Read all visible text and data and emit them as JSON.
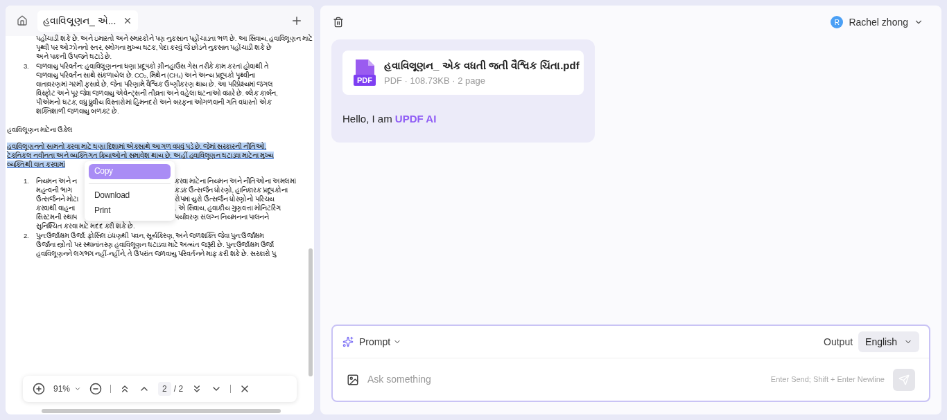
{
  "left_panel": {
    "tab": {
      "title": "હવાવિલૂણન_ એ...",
      "selected": true
    },
    "document": [
      {
        "kind": "text",
        "text": "પહોંચાડી શકે છે. અને ઇમારતો અને સ્મારકોને પણ નુકસાન પહોંચાડતા ભળ છે. આ સિવાય, હવાવિલૂણન માટે",
        "highlighted": false
      },
      {
        "kind": "text",
        "text": "પૃથ્વી પર ઓઝોનનો સ્તર, સ્મોગના મુખ્ય ઘટક, પેદા કરવું જે છોડને નુકસાન પહોંચાડી શકે છે",
        "highlighted": false
      },
      {
        "kind": "text",
        "text": "અને પાકની ઉપજને ઘટાડે છે.",
        "highlighted": false
      },
      {
        "kind": "item",
        "number": "3.",
        "text": "જળવાયુ પરિવર્તન: હવાવિલૂણનના ઘણા પ્રદૂષકો ગ્રીનહાઉસ ગેસ તરીકે કામ કરતાં હોવાથી તે",
        "highlighted": false
      },
      {
        "kind": "text",
        "text": "જળવાયુ પરિવર્તન સાથે સંકળાયેલ છે. CO₂, મિથેન (CH₄) અને અન્ય પ્રદૂષકો પૃથ્વીના",
        "highlighted": false
      },
      {
        "kind": "text",
        "text": "વાતાવરણમાં ગરમી ફસાવે છે, જેના પરિણામે વૈશ્વિક ઉષ્ણીકરણ થાય છે. આ પરિપ્રેક્ષ્યમાં જંગલ",
        "highlighted": false
      },
      {
        "kind": "text",
        "text": "વિસ્ફોટ અને પૂર જેવા જળવાયુ એવેન્ટ્સની તીવ્રતા અને વહેલા ઘટનાઓ વધારે છે. બ્લેક કાર્બન,",
        "highlighted": false
      },
      {
        "kind": "text",
        "text": "પીએમનો ઘટક, વધુ ધ્રુવીય વિસ્તારોમાં હિમનદરો અને બરફના ઓગળવાની ગતિ વધારતો એક",
        "highlighted": false
      },
      {
        "kind": "text",
        "text": "શક્તિશાળી જળવાયુ બળકટ છે.",
        "highlighted": false
      },
      {
        "kind": "heading",
        "text": "હવાવિલૂણન માટેના ઉકેલ",
        "highlighted": false
      },
      {
        "kind": "para",
        "text": "હવાવિલૂણનનો સામનો કરવા માટે ઘણા દિશામાં એકસાથે આગળ વધવું પડે છે. જેમાં સરકારની નીતિઓ,",
        "highlighted": true
      },
      {
        "kind": "para",
        "text": "ટેકનિકલ નવીનતા અને વ્યક્તિગત ક્રિયાઓનો સમાવેશ થાય છે. અહીં હવાવિલૂણન ઘટાડવા માટેના મુખ્ય",
        "highlighted": true
      },
      {
        "kind": "para",
        "text": "વ્યક્તિથી વાત કરવામાં",
        "highlighted": true
      },
      {
        "kind": "split",
        "number": "1.",
        "left": "નિયમન અને ન",
        "right": "કરવા માટેના નિયમન અને નીતિઓના અમલમાં",
        "highlighted": false
      },
      {
        "kind": "split",
        "left": "મહત્વની ભાગ",
        "right": "કડક ઉત્સર્જન ધોરણો, હાનિકારક પ્રદૂષકોના",
        "highlighted": false
      },
      {
        "kind": "split",
        "left": "ઉત્સર્જનને મોટા",
        "right": "રોપમાં યુરો ઉત્સર્જન ધોરણોનો પરિચય",
        "highlighted": false
      },
      {
        "kind": "split",
        "left": "કરવાથી વાહના",
        "right": ". એ સિવાય, હવાકીય ગુણવત્તા મોનિટરિંગ",
        "highlighted": false
      },
      {
        "kind": "split",
        "left": "સિસ્ટમની સ્થાપ",
        "right": "પર્યાવરણ સંલગ્ન નિયમનના પાલનને",
        "highlighted": false
      },
      {
        "kind": "text",
        "text": "સુનિશ્ચિત કરવા માટે મદદ કરી શકે છે.",
        "highlighted": false
      },
      {
        "kind": "item",
        "number": "2.",
        "text": "પુન:ઉર્જાક્ષમ ઉર્જા: ફોસિલ ઇંધણથી પવન, સૂર્યકિરણ, અને જળશક્તિ જેવા પુન:ઉર્જાક્ષમ",
        "highlighted": false
      },
      {
        "kind": "text",
        "text": "ઉર્જાના સ્ત્રોતો પર સ્થાનાંતરણ હવાવિલૂણન ઘટાડવા માટે અત્યંત જરૂરી છે. પુન:ઉર્જાક્ષમ ઉર્જા",
        "highlighted": false
      },
      {
        "kind": "text",
        "text": "હવાવિલૂણનને લગભગ નહીં-નહીંને, તે ઉપરાંત જળવાયુ પરિવર્તનને માફ કરી શકે છે. સરકારો પુ",
        "highlighted": false
      }
    ],
    "context_menu": [
      {
        "label": "Copy",
        "selected": true
      },
      {
        "label": "Download",
        "selected": false
      },
      {
        "label": "Print",
        "selected": false
      }
    ],
    "toolbar": {
      "zoom": "91%",
      "page": "2",
      "total": "/ 2"
    }
  },
  "right_panel": {
    "user": {
      "initial": "R",
      "name": "Rachel zhong"
    },
    "file": {
      "name": "હવાવિલૂણન_ એક વધતી જતી વૈશ્વિક ચિંતા.pdf",
      "icon_label": "PDF",
      "meta": "PDF · 108.73KB · 2 page"
    },
    "greeting": "Hello, I am ",
    "brand": "UPDF AI",
    "composer": {
      "prompt": "Prompt",
      "output_label": "Output",
      "language": "English",
      "placeholder": "Ask something",
      "hint": "Enter Send; Shift + Enter Newline"
    }
  }
}
